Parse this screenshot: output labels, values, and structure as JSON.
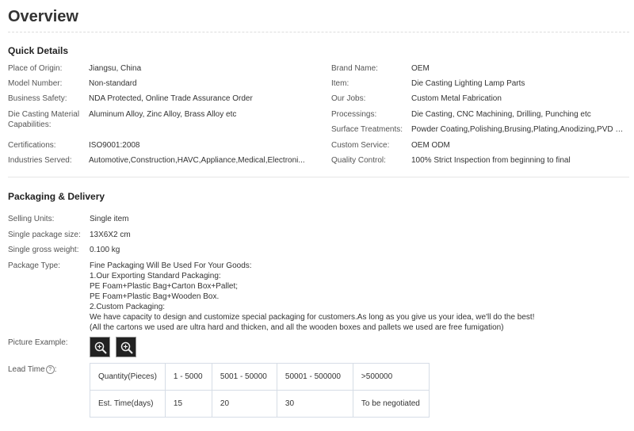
{
  "title": "Overview",
  "quick_details": {
    "heading": "Quick Details",
    "left": [
      {
        "label": "Place of Origin:",
        "value": "Jiangsu, China"
      },
      {
        "label": "Model Number:",
        "value": "Non-standard"
      },
      {
        "label": "Business Safety:",
        "value": "NDA Protected, Online Trade Assurance Order"
      },
      {
        "label": "Die Casting Material Capabilities:",
        "value": "Aluminum Alloy, Zinc Alloy, Brass Alloy etc"
      },
      {
        "label": "Certifications:",
        "value": "ISO9001:2008"
      },
      {
        "label": "Industries Served:",
        "value": "Automotive,Construction,HAVC,Appliance,Medical,Electroni..."
      }
    ],
    "right": [
      {
        "label": "Brand Name:",
        "value": "OEM"
      },
      {
        "label": "Item:",
        "value": "Die Casting Lighting Lamp Parts"
      },
      {
        "label": "Our Jobs:",
        "value": "Custom Metal Fabrication"
      },
      {
        "label": "Processings:",
        "value": "Die Casting, CNC Machining, Drilling, Punching etc"
      },
      {
        "label": "Surface Treatments:",
        "value": "Powder Coating,Polishing,Brusing,Plating,Anodizing,PVD Co..."
      },
      {
        "label": "Custom Service:",
        "value": "OEM ODM"
      },
      {
        "label": "Quality Control:",
        "value": "100% Strict Inspection from beginning to final"
      }
    ]
  },
  "packaging": {
    "heading": "Packaging & Delivery",
    "rows": [
      {
        "label": "Selling Units:",
        "value": "Single item"
      },
      {
        "label": "Single package size:",
        "value": "13X6X2 cm"
      },
      {
        "label": "Single gross weight:",
        "value": "0.100 kg"
      }
    ],
    "package_type_label": "Package Type:",
    "package_type_lines": [
      "Fine Packaging Will Be Used For Your Goods:",
      "1.Our Exporting Standard Packaging:",
      "PE Foam+Plastic Bag+Carton Box+Pallet;",
      "PE Foam+Plastic Bag+Wooden Box.",
      "2.Custom Packaging:",
      "We have capacity to design and customize special packaging for customers.As long as you give us your idea, we'll do the best!",
      "(All the cartons we used are ultra hard and thicken, and all the wooden boxes and pallets we used are free fumigation)"
    ],
    "picture_label": "Picture Example:",
    "lead_time_label": "Lead Time",
    "lead_time_table": {
      "row1": [
        "Quantity(Pieces)",
        "1 - 5000",
        "5001 - 50000",
        "50001 - 500000",
        ">500000"
      ],
      "row2": [
        "Est. Time(days)",
        "15",
        "20",
        "30",
        "To be negotiated"
      ]
    }
  }
}
